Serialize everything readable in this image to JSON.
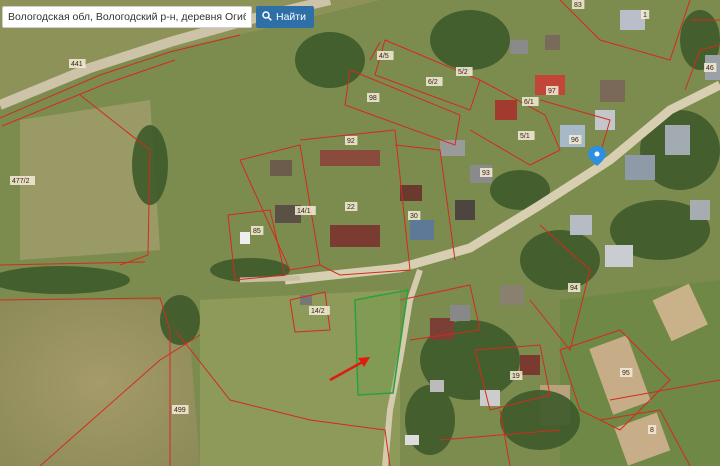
{
  "search": {
    "value": "Вологодская обл, Вологодский р-н, деревня Огибалово",
    "button_label": "Найти"
  },
  "plot_labels": [
    "83",
    "1",
    "46",
    "441",
    "4/5",
    "6/2",
    "5/2",
    "6/1",
    "97",
    "98",
    "92",
    "5/1",
    "96",
    "93",
    "477/2",
    "14/1",
    "22",
    "30",
    "85",
    "14/2",
    "94",
    "95",
    "19",
    "499",
    "8"
  ],
  "colors": {
    "boundary": "#d42a1e",
    "selected_plot": "#2aa13a",
    "arrow": "#e01b10",
    "marker": "#2d8fe0",
    "search_button": "#2f6fa8"
  },
  "icons": [
    "search-icon",
    "location-pin-icon",
    "pointer-arrow-icon"
  ]
}
